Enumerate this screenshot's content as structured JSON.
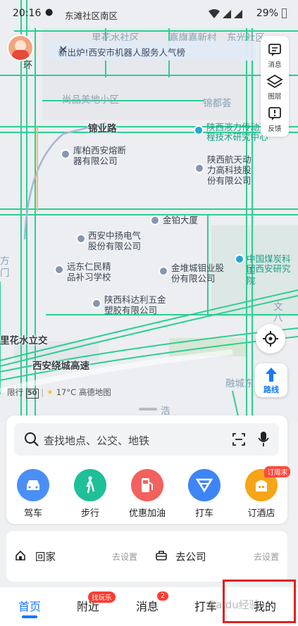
{
  "status_bar": {
    "time": "20:16",
    "location": "东滩社区南区",
    "battery": "29%"
  },
  "notice": {
    "text": "新出炉!西安市机器人服务人气榜"
  },
  "avatar": {
    "caption": "环"
  },
  "side_panel": [
    {
      "label": "消息",
      "icon": "message-icon"
    },
    {
      "label": "图层",
      "icon": "layers-icon"
    },
    {
      "label": "反馈",
      "icon": "feedback-icon"
    }
  ],
  "map": {
    "labels": {
      "l1": "里花水社区",
      "l2": "嘉旗嘉新村",
      "l3": "东光社区",
      "l4": "尚品美地小区",
      "l5": "锦都荟",
      "l6": "锦业路",
      "l7": "陕西液力传动工",
      "l8": "程技术研究中心",
      "l9": "库柏西安熔断",
      "l10": "器有限公司",
      "l11": "陕西航天动",
      "l12": "力高科技股",
      "l13": "份有限公司",
      "l14": "金铂大厦",
      "l15": "西安中扬电气",
      "l16": "股份有限公司",
      "l17": "中国煤炭科工",
      "l18": "团西安研究院",
      "l19": "远东仁民精",
      "l20": "品补习学校",
      "l21": "金堆城钼业股",
      "l22": "份有限公司",
      "l23": "陕西科达利五金",
      "l24": "塑胶有限公司",
      "l25": "里花水立交",
      "l26": "西安绕城高速",
      "l27": "文",
      "l28": "八",
      "l29": "融城东",
      "l30": "浩",
      "l31": "方",
      "l32": "门"
    },
    "limit_label": "限行",
    "limit_number": "50",
    "weather": "17°C",
    "brand": "高德地图"
  },
  "route_button": {
    "label": "路线"
  },
  "search": {
    "placeholder": "查找地点、公交、地铁"
  },
  "quick_actions": [
    {
      "label": "驾车",
      "color": "#4b8ff6",
      "tag": ""
    },
    {
      "label": "步行",
      "color": "#1fbf98",
      "tag": ""
    },
    {
      "label": "优惠加油",
      "color": "#f2615e",
      "tag": ""
    },
    {
      "label": "打车",
      "color": "#3d84f7",
      "tag": ""
    },
    {
      "label": "订酒店",
      "color": "#f5a517",
      "tag": "订周末"
    }
  ],
  "shortcuts": {
    "home": {
      "label": "回家",
      "action": "去设置"
    },
    "work": {
      "label": "去公司",
      "action": "去设置"
    }
  },
  "tabs": [
    {
      "label": "首页",
      "badge": ""
    },
    {
      "label": "附近",
      "badge": "找玩乐"
    },
    {
      "label": "消息",
      "badge": "2"
    },
    {
      "label": "打车",
      "badge": ""
    },
    {
      "label": "我的",
      "badge": ""
    }
  ],
  "watermark": "Baidu经验"
}
